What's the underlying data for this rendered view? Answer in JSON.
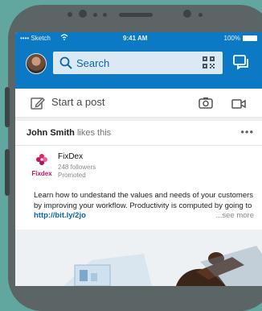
{
  "status_bar": {
    "carrier": "•••• Sketch",
    "wifi": "wifi-icon",
    "time": "9:41 AM",
    "battery": "100%"
  },
  "header": {
    "search_label": "Search",
    "search_icon": "search-icon",
    "qr_icon": "qr-code-icon",
    "messages_icon": "messages-icon"
  },
  "composer": {
    "prompt": "Start a post"
  },
  "activity": {
    "name": "John Smith",
    "action": "likes this",
    "more": "•••"
  },
  "company": {
    "name": "FixDex",
    "followers": "248 followers",
    "promoted": "Promoted",
    "logo_text": "Fixdex"
  },
  "post": {
    "text": "Learn how to undestand the values and needs of your customers by improving your workflow. Productivity is computed by going to",
    "link": "http://bit.ly/2jo",
    "see_more": "...see more"
  },
  "colors": {
    "accent": "#0b79c4",
    "background": "#62a6a0",
    "phone": "#5c6566"
  }
}
